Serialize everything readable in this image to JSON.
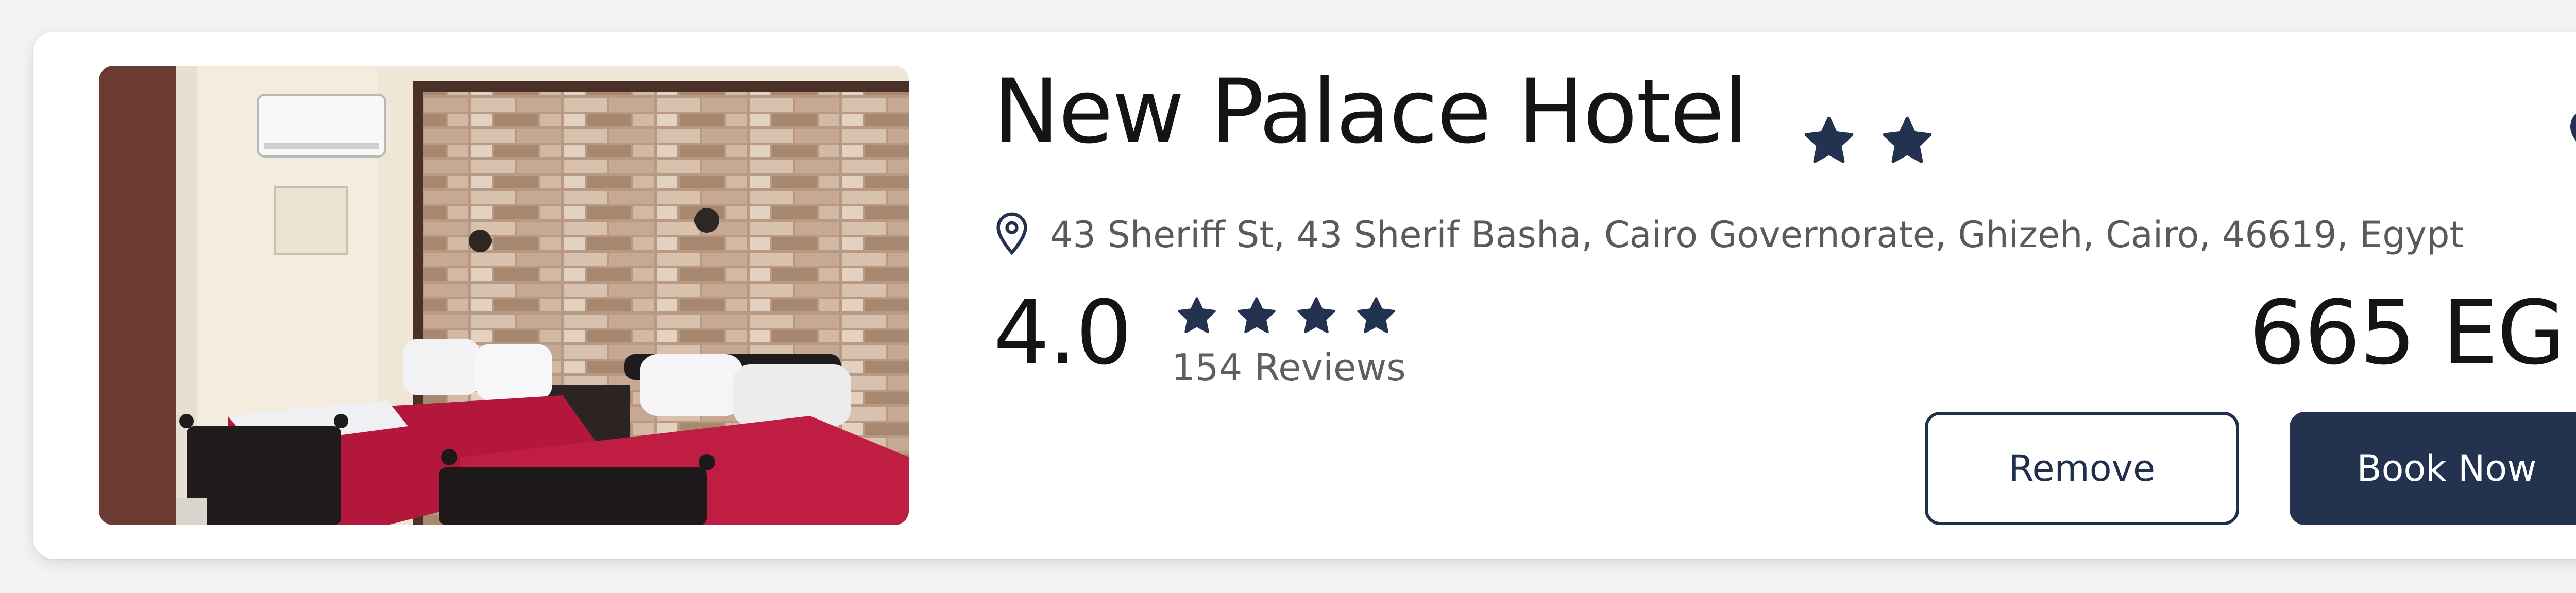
{
  "hotel": {
    "name": "New Palace Hotel",
    "class_stars": 2,
    "address": "43 Sheriff St, 43 Sherif Basha, Cairo Governorate, Ghizeh, Cairo, 46619, Egypt",
    "rating": "4.0",
    "rating_stars": 4,
    "reviews": "154 Reviews",
    "price": "665 EG",
    "favorited": true
  },
  "actions": {
    "remove_label": "Remove",
    "book_label": "Book Now"
  },
  "colors": {
    "navy": "#22324f",
    "text": "#141414",
    "muted": "#5a5a5e"
  },
  "icons": {
    "class_star": "star-icon",
    "rating_star": "star-icon",
    "favorite": "heart-icon",
    "location": "map-pin-icon"
  }
}
